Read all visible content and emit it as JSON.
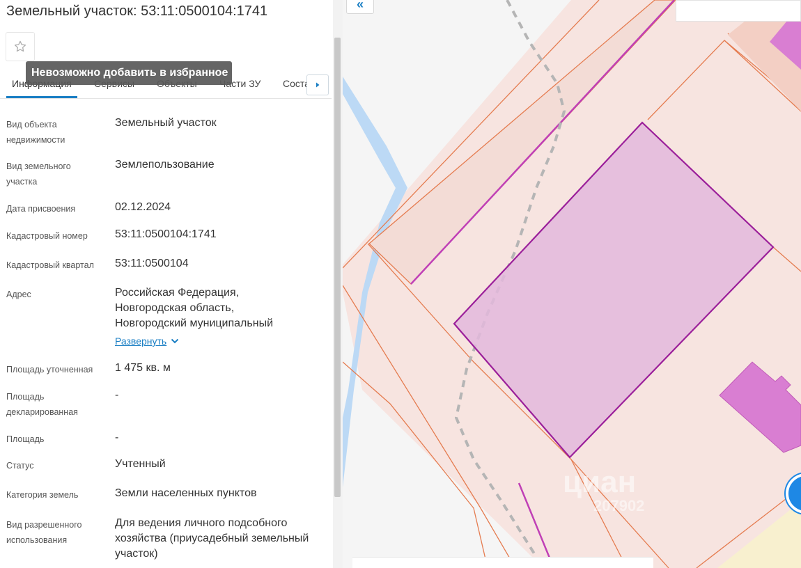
{
  "header": {
    "title": "Земельный участок: 53:11:0500104:1741"
  },
  "favorite": {
    "tooltip": "Невозможно добавить в избранное"
  },
  "tabs": [
    {
      "label": "Информация",
      "active": true
    },
    {
      "label": "Сервисы",
      "active": false
    },
    {
      "label": "Объекты",
      "active": false
    },
    {
      "label": "Части ЗУ",
      "active": false
    },
    {
      "label": "Соста",
      "active": false
    }
  ],
  "fields": {
    "object_type": {
      "label": "Вид объекта недвижимости",
      "value": "Земельный участок"
    },
    "land_type": {
      "label": "Вид земельного участка",
      "value": "Землепользование"
    },
    "date": {
      "label": "Дата присвоения",
      "value": "02.12.2024"
    },
    "cadastral_number": {
      "label": "Кадастровый номер",
      "value": "53:11:0500104:1741"
    },
    "cadastral_quarter": {
      "label": "Кадастровый квартал",
      "value": "53:11:0500104"
    },
    "address": {
      "label": "Адрес",
      "value": "Российская Федерация, Новгородская область, Новгородский муниципальный",
      "expand": "Развернуть"
    },
    "area_refined": {
      "label": "Площадь уточненная",
      "value": "1 475 кв. м"
    },
    "area_declared": {
      "label": "Площадь декларированная",
      "value": "-"
    },
    "area": {
      "label": "Площадь",
      "value": "-"
    },
    "status": {
      "label": "Статус",
      "value": "Учтенный"
    },
    "land_category": {
      "label": "Категория земель",
      "value": "Земли населенных пунктов"
    },
    "permitted_use": {
      "label": "Вид разрешенного использования",
      "value": "Для ведения личного подсобного хозяйства (приусадебный земельный участок)"
    }
  },
  "map": {
    "collapse_label": "«",
    "watermark": "циан",
    "watermark_sub": "207902"
  },
  "colors": {
    "accent": "#1b7fc4",
    "parcel_fill": "#e3b8dc",
    "parcel_border": "#9b1f9a",
    "plot_fill": "#f9e3df",
    "plot_border": "#e57c50",
    "water": "#bcd9f5"
  }
}
